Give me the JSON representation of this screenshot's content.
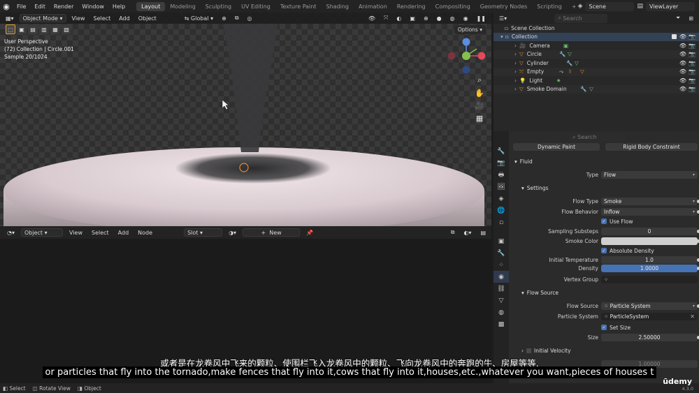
{
  "topbar": {
    "menus": [
      "File",
      "Edit",
      "Render",
      "Window",
      "Help"
    ],
    "workspaces": [
      "Layout",
      "Modeling",
      "Sculpting",
      "UV Editing",
      "Texture Paint",
      "Shading",
      "Animation",
      "Rendering",
      "Compositing",
      "Geometry Nodes",
      "Scripting",
      "+"
    ],
    "active_workspace": "Layout",
    "scene": "Scene",
    "view_layer": "ViewLayer"
  },
  "viewport": {
    "mode": "Object Mode",
    "menus": [
      "View",
      "Select",
      "Add",
      "Object"
    ],
    "transform": "Global",
    "options": "Options",
    "overlay_lines": [
      "User Perspective",
      "(72) Collection | Circle.001",
      "Sample 20/1024"
    ]
  },
  "node_editor": {
    "type": "Object",
    "menus": [
      "View",
      "Select",
      "Add",
      "Node"
    ],
    "slot": "Slot",
    "new_label": "New"
  },
  "outliner": {
    "search_placeholder": "Search",
    "root": "Scene Collection",
    "collection": "Collection",
    "items": [
      {
        "name": "Camera",
        "icon": "camera-icon"
      },
      {
        "name": "Circle",
        "icon": "mesh-icon"
      },
      {
        "name": "Cylinder",
        "icon": "mesh-icon"
      },
      {
        "name": "Empty",
        "icon": "empty-icon"
      },
      {
        "name": "Light",
        "icon": "light-icon"
      },
      {
        "name": "Smoke Domain",
        "icon": "mesh-icon"
      }
    ]
  },
  "properties": {
    "search_placeholder": "Search",
    "buttons": [
      "Dynamic Paint",
      "Rigid Body Constraint"
    ],
    "fluid_header": "Fluid",
    "type_label": "Type",
    "type_value": "Flow",
    "settings_header": "Settings",
    "flow_type_label": "Flow Type",
    "flow_type_value": "Smoke",
    "flow_behavior_label": "Flow Behavior",
    "flow_behavior_value": "Inflow",
    "use_flow": "Use Flow",
    "sampling_label": "Sampling Substeps",
    "sampling_value": "0",
    "smoke_color_label": "Smoke Color",
    "absolute_density": "Absolute Density",
    "initial_temp_label": "Initial Temperature",
    "initial_temp_value": "1.0",
    "density_label": "Density",
    "density_value": "1.0000",
    "vertex_group_label": "Vertex Group",
    "flow_source_header": "Flow Source",
    "flow_source_label": "Flow Source",
    "flow_source_value": "Particle System",
    "particle_system_label": "Particle System",
    "particle_system_value": "ParticleSystem",
    "set_size": "Set Size",
    "size_label": "Size",
    "size_value": "2.50000",
    "initial_velocity_header": "Initial Velocity",
    "source_value": "1.00000"
  },
  "subtitles": {
    "chinese": "或者是在龙卷风中飞来的颗粒、使围栏飞入龙卷风中的颗粒、飞向龙卷风中的奔跑的牛、房屋等等,",
    "english": "or particles that fly into the tornado,make fences that fly into it,cows that fly into it,houses,etc.,whatever you want,pieces of houses t"
  },
  "statusbar": {
    "items": [
      "Select",
      "Rotate View",
      "Object"
    ],
    "watermark": "ūdemy",
    "version": "4.3.0"
  },
  "colors": {
    "accent": "#4772b3",
    "orange": "#e0a030",
    "green": "#6fc36f"
  }
}
